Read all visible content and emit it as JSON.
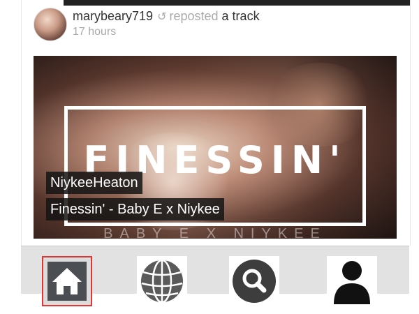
{
  "post": {
    "username": "marybeary719",
    "action": "reposted",
    "object": "a track",
    "time": "17 hours",
    "icons": {
      "avatar": "user-avatar",
      "repost": "repost-icon"
    }
  },
  "track": {
    "artist": "NiykeeHeaton",
    "title": "Finessin' - Baby E x Niykee",
    "artwork_title": "FINESSIN'",
    "artwork_subtitle": "BABY E X NIYKEE"
  },
  "tabbar": {
    "tabs": [
      {
        "name": "home",
        "icon": "home-icon",
        "selected": true
      },
      {
        "name": "explore",
        "icon": "globe-icon",
        "selected": false
      },
      {
        "name": "search",
        "icon": "search-icon",
        "selected": false
      },
      {
        "name": "profile",
        "icon": "user-icon",
        "selected": false
      }
    ],
    "selected_color": "#e03535"
  }
}
